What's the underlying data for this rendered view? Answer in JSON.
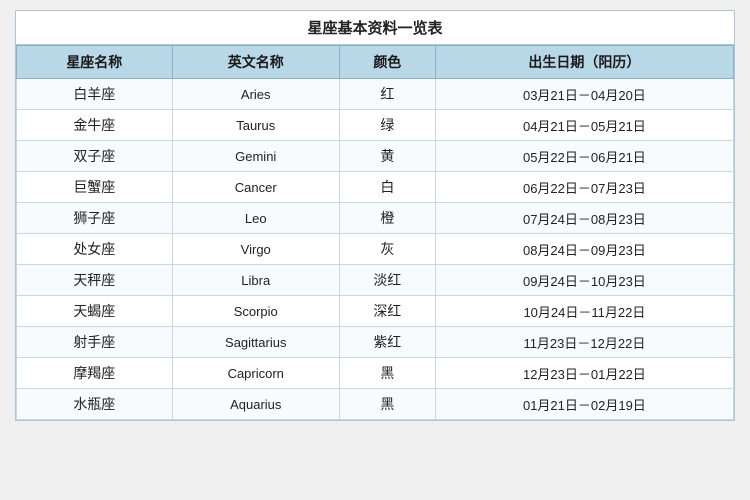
{
  "title": "星座基本资料一览表",
  "headers": [
    "星座名称",
    "英文名称",
    "颜色",
    "出生日期（阳历）"
  ],
  "rows": [
    {
      "chinese": "白羊座",
      "english": "Aries",
      "color": "红",
      "date": "03月21日－04月20日"
    },
    {
      "chinese": "金牛座",
      "english": "Taurus",
      "color": "绿",
      "date": "04月21日－05月21日"
    },
    {
      "chinese": "双子座",
      "english": "Gemini",
      "color": "黄",
      "date": "05月22日－06月21日"
    },
    {
      "chinese": "巨蟹座",
      "english": "Cancer",
      "color": "白",
      "date": "06月22日－07月23日"
    },
    {
      "chinese": "狮子座",
      "english": "Leo",
      "color": "橙",
      "date": "07月24日－08月23日"
    },
    {
      "chinese": "处女座",
      "english": "Virgo",
      "color": "灰",
      "date": "08月24日－09月23日"
    },
    {
      "chinese": "天秤座",
      "english": "Libra",
      "color": "淡红",
      "date": "09月24日－10月23日"
    },
    {
      "chinese": "天蝎座",
      "english": "Scorpio",
      "color": "深红",
      "date": "10月24日－11月22日"
    },
    {
      "chinese": "射手座",
      "english": "Sagittarius",
      "color": "紫红",
      "date": "11月23日－12月22日"
    },
    {
      "chinese": "摩羯座",
      "english": "Capricorn",
      "color": "黑",
      "date": "12月23日－01月22日"
    },
    {
      "chinese": "水瓶座",
      "english": "Aquarius",
      "color": "黑",
      "date": "01月21日－02月19日"
    }
  ]
}
